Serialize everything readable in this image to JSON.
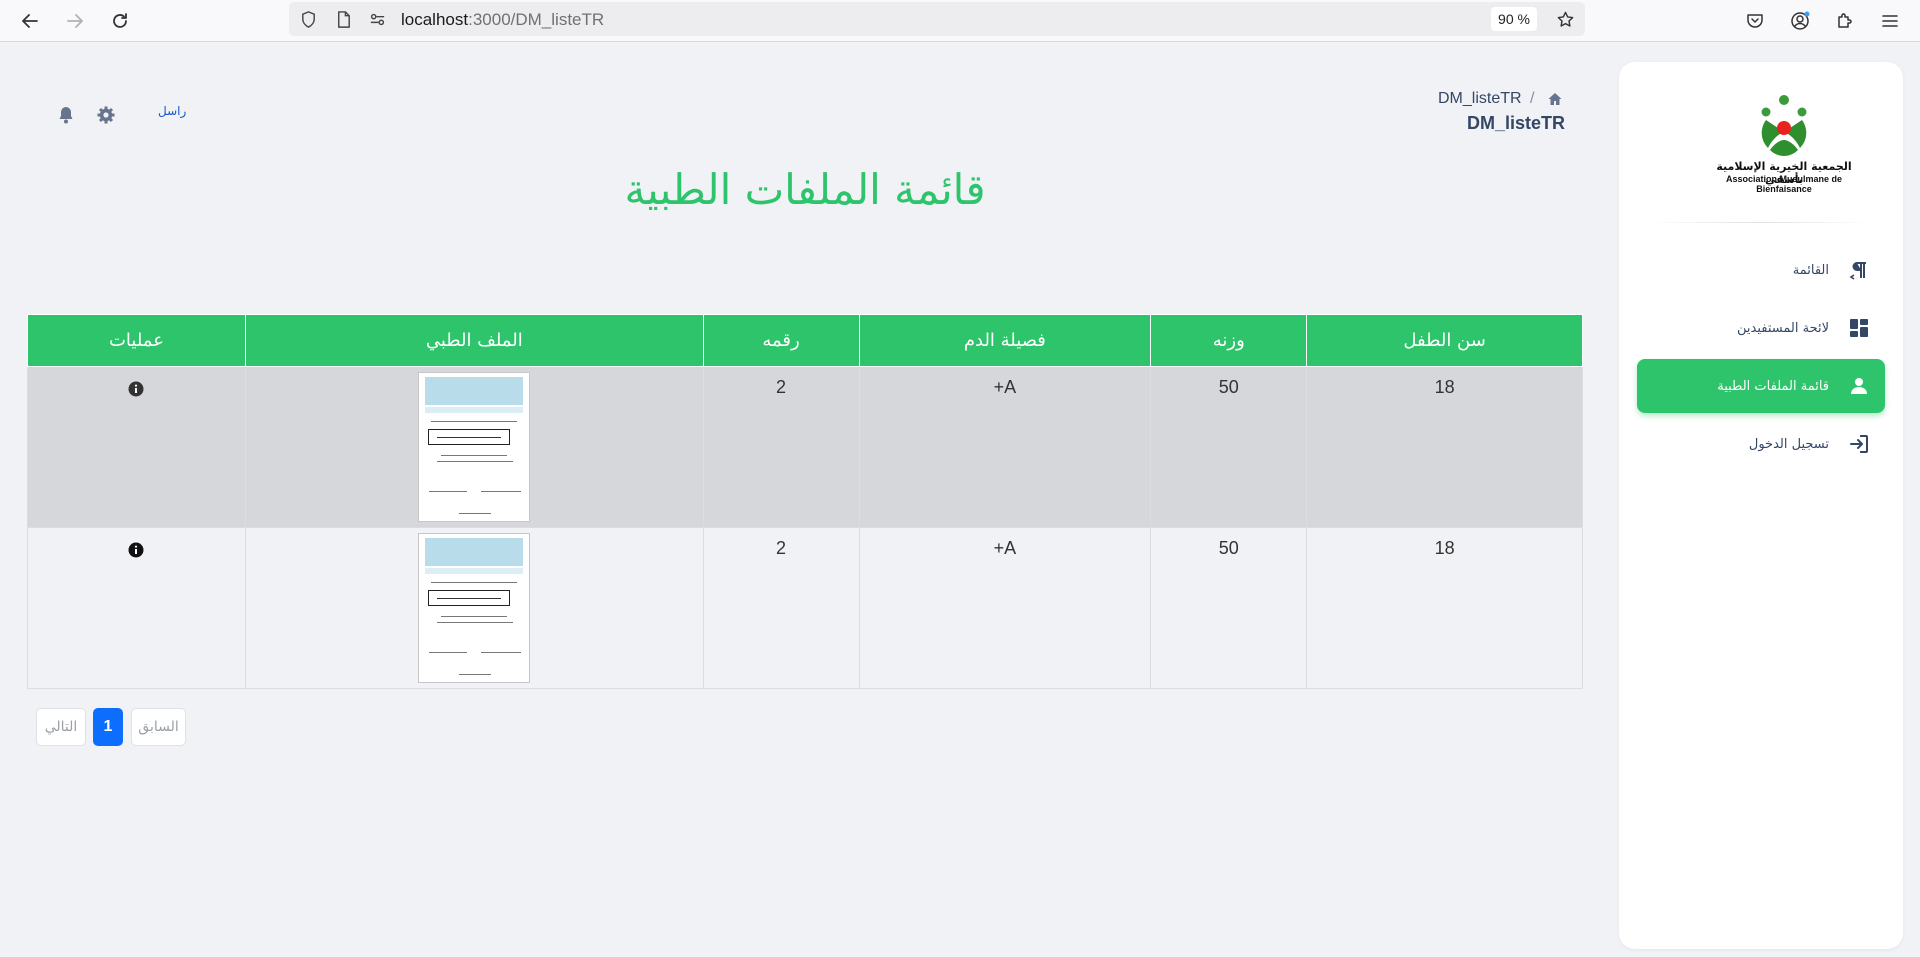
{
  "browser": {
    "url_host": "localhost",
    "url_path": ":3000/DM_listeTR",
    "zoom": "90 %"
  },
  "sidebar": {
    "logo_text_ar": "الجمعية الخيرية الإسلامية بأسفي",
    "logo_text_fr": "Association Musulmane de Bienfaisance",
    "items": [
      {
        "label": "القائمة",
        "icon": "paragraph-icon",
        "active": false
      },
      {
        "label": "لائحة المستفيدين",
        "icon": "dashboard-icon",
        "active": false
      },
      {
        "label": "قائمة الملفات الطبية",
        "icon": "user-icon",
        "active": true
      },
      {
        "label": "تسجيل الدخول",
        "icon": "login-icon",
        "active": false
      }
    ]
  },
  "header": {
    "breadcrumb": "DM_listeTR",
    "breadcrumb_separator": "/",
    "subtitle": "DM_listeTR",
    "link": "راسل"
  },
  "page_title": "قائمة الملفات الطبية",
  "table": {
    "columns": [
      "سن الطفل",
      "وزنه",
      "فصيلة الدم",
      "رقمه",
      "الملف الطبي",
      "عمليات"
    ],
    "rows": [
      {
        "age": "18",
        "weight": "50",
        "blood": "A+",
        "number": "2"
      },
      {
        "age": "18",
        "weight": "50",
        "blood": "A+",
        "number": "2"
      }
    ]
  },
  "pagination": {
    "prev": "السابق",
    "current": "1",
    "next": "التالي"
  },
  "colors": {
    "accent": "#2dc46b",
    "page_bg": "#f0f2f5",
    "pager_current": "#0d6efd"
  }
}
